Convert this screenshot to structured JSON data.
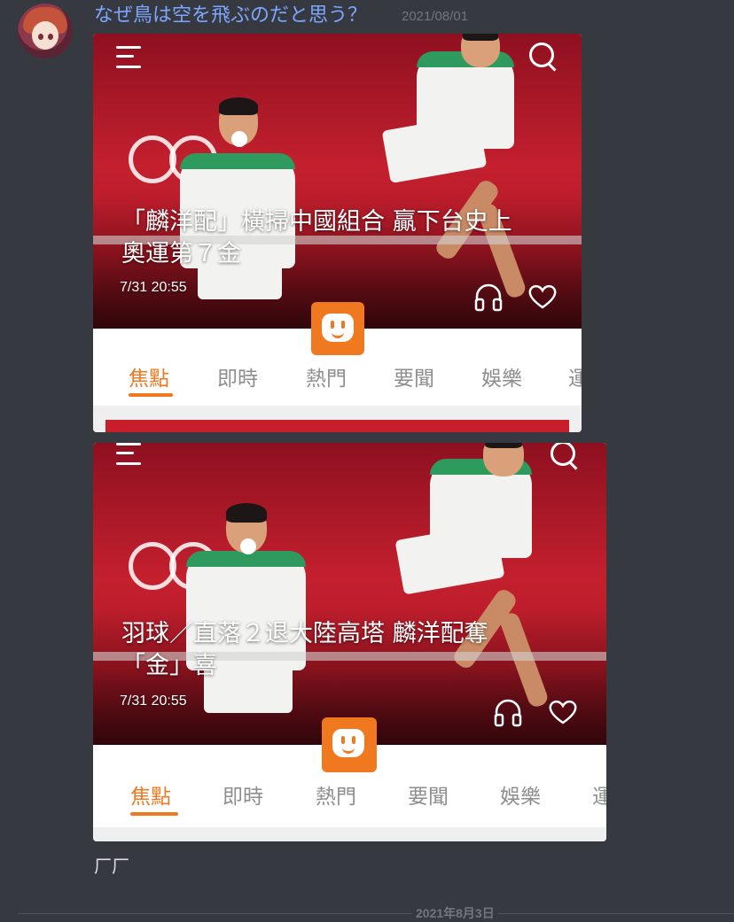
{
  "message": {
    "username": "なぜ鳥は空を飛ぶのだと思う？",
    "timestamp": "2021/08/01",
    "text": "厂厂"
  },
  "screenshots": [
    {
      "headline_line1": "「麟洋配」橫掃中國組合 贏下台史上",
      "headline_line2": "奧運第７金",
      "date": "7/31 20:55",
      "tabs": [
        "焦點",
        "即時",
        "熱門",
        "要聞",
        "娛樂",
        "運"
      ],
      "active_tab": "焦點"
    },
    {
      "headline_line1": "羽球／直落２退大陸高塔 麟洋配奪",
      "headline_line2": "「金」喜",
      "date": "7/31 20:55",
      "tabs": [
        "焦點",
        "即時",
        "熱門",
        "要聞",
        "娛樂",
        "運"
      ],
      "active_tab": "焦點"
    }
  ],
  "date_divider": "2021年8月3日",
  "colors": {
    "background": "#36393f",
    "username": "#7ea6ff",
    "accent": "#f0781e"
  },
  "icons": [
    "menu-icon",
    "search-icon",
    "headphones-icon",
    "heart-icon",
    "app-logo-icon"
  ]
}
